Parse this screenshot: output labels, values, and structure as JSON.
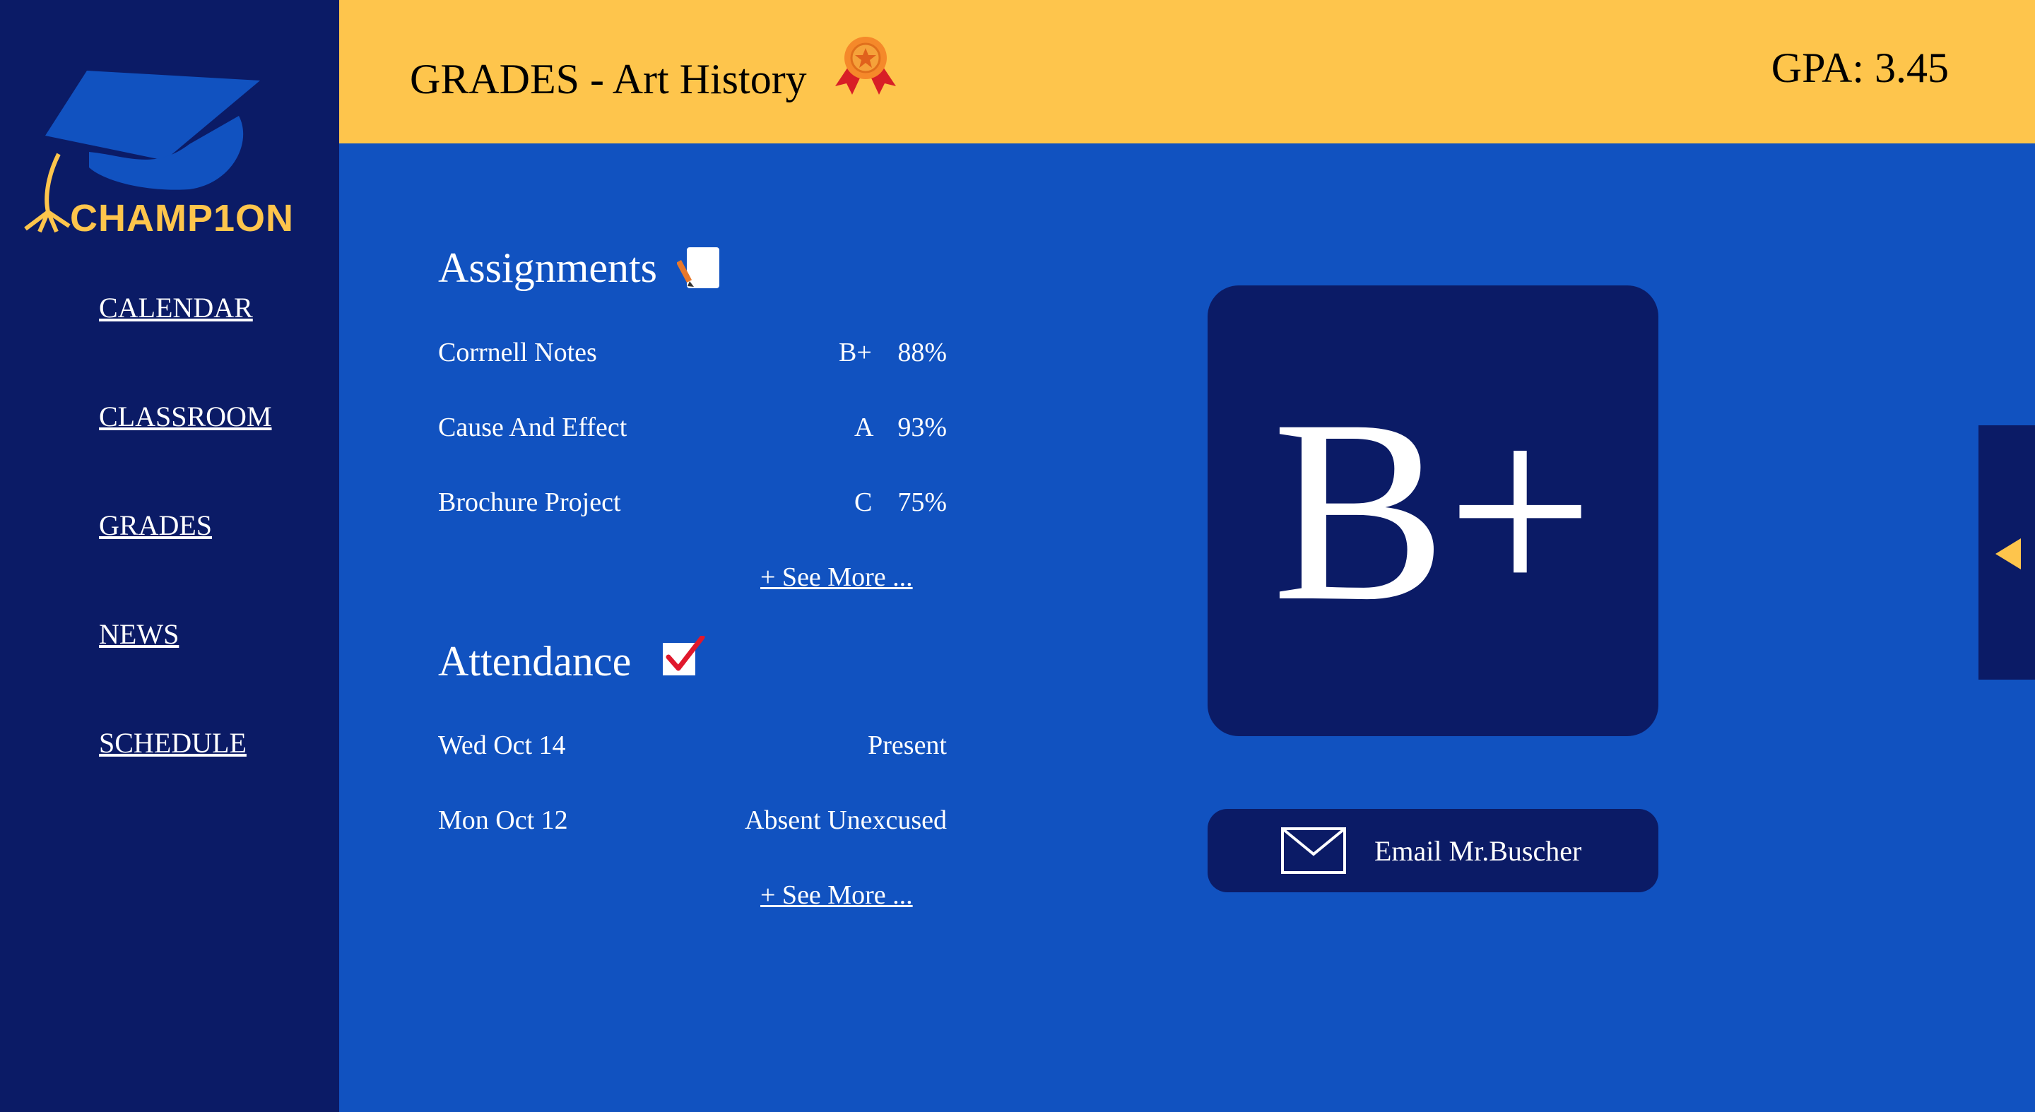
{
  "brand": {
    "logo_text": "CHAMP1ON"
  },
  "nav": {
    "items": [
      {
        "label": "CALENDAR"
      },
      {
        "label": "CLASSROOM"
      },
      {
        "label": "GRADES"
      },
      {
        "label": "NEWS"
      },
      {
        "label": "SCHEDULE"
      }
    ]
  },
  "header": {
    "title": "GRADES - Art History",
    "gpa": "GPA: 3.45",
    "award_icon": "ribbon-medal-icon"
  },
  "assignments": {
    "title": "Assignments",
    "icon": "notepad-pencil-icon",
    "rows": [
      {
        "name": "Corrnell Notes",
        "grade": "B+",
        "percent": "88%"
      },
      {
        "name": "Cause And Effect",
        "grade": "A",
        "percent": "93%"
      },
      {
        "name": "Brochure Project",
        "grade": "C",
        "percent": "75%"
      }
    ],
    "see_more": "+ See More ..."
  },
  "attendance": {
    "title": "Attendance",
    "icon": "checkbox-checked-icon",
    "rows": [
      {
        "date": "Wed Oct 14",
        "status": "Present"
      },
      {
        "date": "Mon Oct 12",
        "status": "Absent Unexcused"
      }
    ],
    "see_more": "+ See More ..."
  },
  "grade_card": {
    "letter": "B+"
  },
  "email": {
    "label": "Email Mr.Buscher",
    "icon": "envelope-icon"
  },
  "side_tab": {
    "icon": "arrow-left-icon"
  },
  "colors": {
    "sidebar": "#0b1b66",
    "main": "#1152c0",
    "header": "#fec54c",
    "accent": "#fec54c",
    "text": "#ffffff"
  }
}
